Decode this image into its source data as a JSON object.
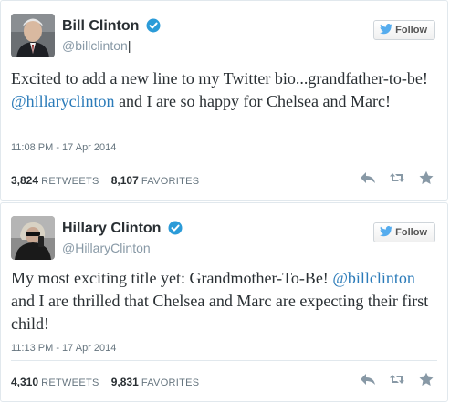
{
  "tweets": [
    {
      "name": "Bill Clinton",
      "handle": "@billclinton",
      "follow_label": "Follow",
      "text_parts": {
        "p1": "Excited to add a new line to my Twitter bio...grandfather-to-be! ",
        "mention": "@hillaryclinton",
        "p2": " and I are so happy for Chelsea and Marc!"
      },
      "timestamp": "11:08 PM - 17 Apr 2014",
      "retweets": "3,824",
      "favorites": "8,107"
    },
    {
      "name": "Hillary Clinton",
      "handle": "@HillaryClinton",
      "follow_label": "Follow",
      "text_parts": {
        "p1": "My most exciting title yet: Grandmother-To-Be! ",
        "mention": "@billclinton",
        "p2": " and I are thrilled that Chelsea and Marc are expecting their first child!"
      },
      "timestamp": "11:13 PM - 17 Apr 2014",
      "retweets": "4,310",
      "favorites": "9,831"
    }
  ],
  "labels": {
    "retweets": "RETWEETS",
    "favorites": "FAVORITES"
  },
  "icons": {
    "verified": "verified-badge-icon",
    "bird": "twitter-bird-icon",
    "reply": "reply-icon",
    "retweet": "retweet-icon",
    "favorite": "star-icon"
  },
  "colors": {
    "link": "#2b7bb9",
    "verified": "#2b9bd8",
    "bird": "#55acee",
    "muted": "#66757f"
  }
}
